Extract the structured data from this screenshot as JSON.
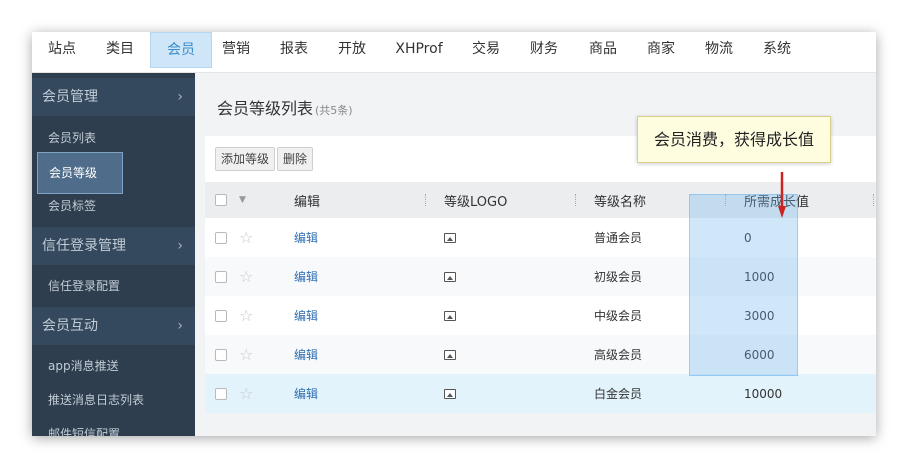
{
  "topnav": {
    "items": [
      "站点",
      "类目",
      "会员",
      "营销",
      "报表",
      "开放",
      "XHProf",
      "交易",
      "财务",
      "商品",
      "商家",
      "物流",
      "系统"
    ],
    "active": "会员"
  },
  "sidebar": {
    "group1": {
      "label": "会员管理",
      "chevron": "›"
    },
    "item_list": "会员列表",
    "item_level": "会员等级",
    "item_tag": "会员标签",
    "group2": {
      "label": "信任登录管理",
      "chevron": "›"
    },
    "item_trust_config": "信任登录配置",
    "group3": {
      "label": "会员互动",
      "chevron": "›"
    },
    "item_app_push": "app消息推送",
    "item_push_log": "推送消息日志列表",
    "item_mail": "邮件短信配置"
  },
  "main": {
    "title": "会员等级列表",
    "count": "(共5条)",
    "toolbar": {
      "add_label": "添加等级",
      "delete_label": "删除"
    },
    "columns": {
      "edit": "编辑",
      "logo": "等级LOGO",
      "name": "等级名称",
      "growth": "所需成长值"
    },
    "rows": [
      {
        "edit": "编辑",
        "name": "普通会员",
        "growth": "0"
      },
      {
        "edit": "编辑",
        "name": "初级会员",
        "growth": "1000"
      },
      {
        "edit": "编辑",
        "name": "中级会员",
        "growth": "3000"
      },
      {
        "edit": "编辑",
        "name": "高级会员",
        "growth": "6000"
      },
      {
        "edit": "编辑",
        "name": "白金会员",
        "growth": "10000"
      }
    ]
  },
  "callout": {
    "text": "会员消费，获得成长值"
  },
  "colors": {
    "accent": "#3a8ccc",
    "sidebar_bg": "#2e3e4e",
    "link": "#2f6fb3",
    "arrow": "#cc2222"
  },
  "icons": {
    "star": "star-outline-icon",
    "logo": "image-icon",
    "caret": "caret-down-icon",
    "chevron": "chevron-right-icon"
  }
}
